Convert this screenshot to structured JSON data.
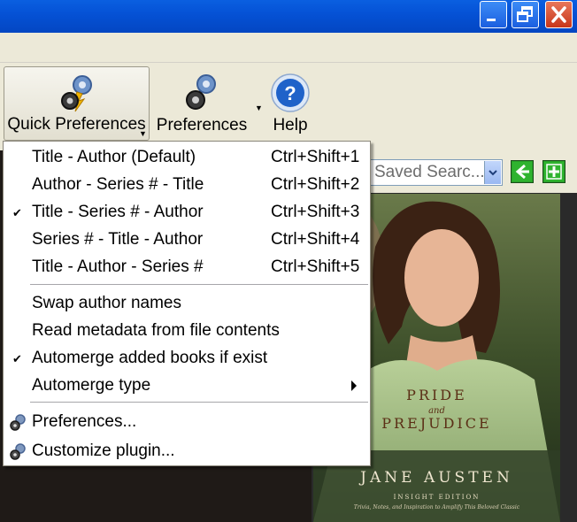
{
  "window": {
    "minimize_icon": "minimize-icon",
    "maximize_icon": "restore-icon",
    "close_icon": "close-icon",
    "titlebar_color": "#0552d6"
  },
  "toolbar": {
    "quick_prefs_label": "Quick Preferences",
    "preferences_label": "Preferences",
    "help_label": "Help"
  },
  "search": {
    "saved_search_value": "Saved Searc..."
  },
  "menu": {
    "items": [
      {
        "label": "Title - Author (Default)",
        "shortcut": "Ctrl+Shift+1",
        "checked": false
      },
      {
        "label": "Author - Series # - Title",
        "shortcut": "Ctrl+Shift+2",
        "checked": false
      },
      {
        "label": "Title - Series # - Author",
        "shortcut": "Ctrl+Shift+3",
        "checked": true
      },
      {
        "label": "Series # - Title - Author",
        "shortcut": "Ctrl+Shift+4",
        "checked": false
      },
      {
        "label": "Title - Author - Series #",
        "shortcut": "Ctrl+Shift+5",
        "checked": false
      }
    ],
    "options": [
      {
        "label": "Swap author names",
        "checked": false
      },
      {
        "label": "Read metadata from file contents",
        "checked": false
      },
      {
        "label": "Automerge added books if exist",
        "checked": true
      },
      {
        "label": "Automerge type",
        "submenu": true
      }
    ],
    "preferences_label": "Preferences...",
    "customize_label": "Customize plugin..."
  },
  "cover": {
    "title_line1": "PRIDE",
    "title_and": "and",
    "title_line2": "PREJUDICE",
    "author": "JANE AUSTEN",
    "edition": "INSIGHT EDITION",
    "tagline": "Trivia, Notes, and Inspiration to Amplify This Beloved Classic"
  },
  "colors": {
    "accent_green": "#29a329",
    "menu_bg": "#ffffff",
    "toolbar_bg": "#ece9d8"
  }
}
